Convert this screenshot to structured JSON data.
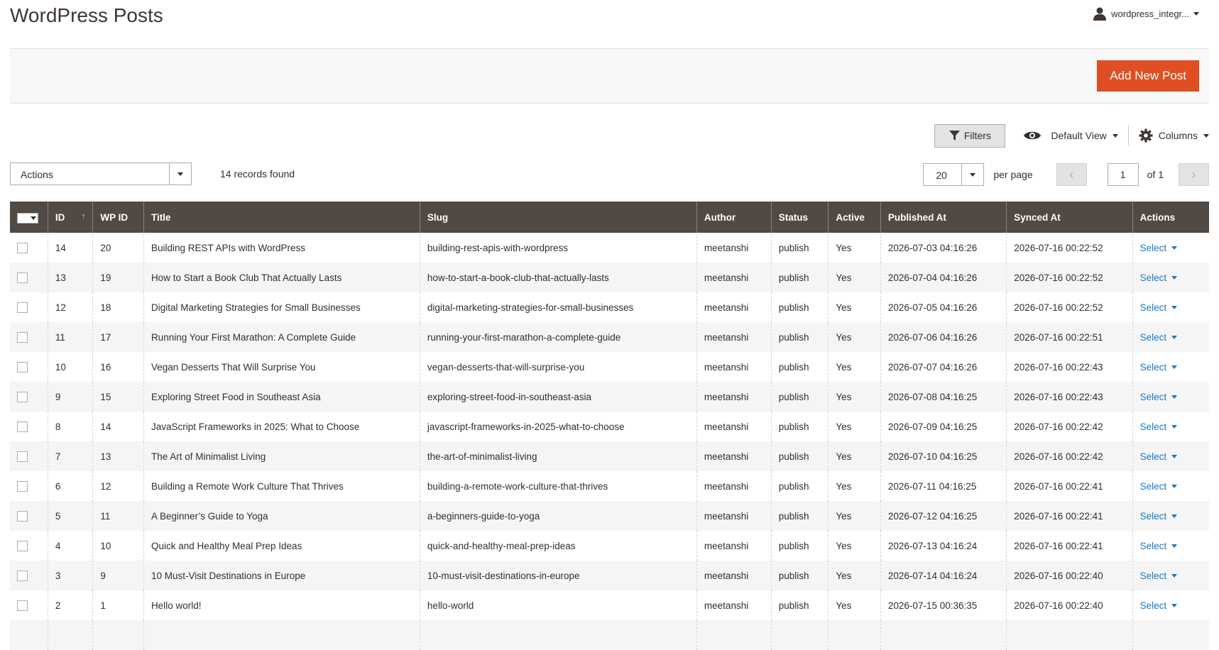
{
  "page": {
    "title": "WordPress Posts"
  },
  "user": {
    "name": "wordpress_integr..."
  },
  "action_bar": {
    "add_button": "Add New Post"
  },
  "toolbar": {
    "filters_label": "Filters",
    "view_label": "Default View",
    "columns_label": "Columns"
  },
  "mass_actions": {
    "label": "Actions"
  },
  "records_found": "14 records found",
  "pager": {
    "per_page_value": "20",
    "per_page_label": "per page",
    "current_page": "1",
    "of_label": "of 1"
  },
  "columns": [
    "ID",
    "WP ID",
    "Title",
    "Slug",
    "Author",
    "Status",
    "Active",
    "Published At",
    "Synced At",
    "Actions"
  ],
  "rows": [
    {
      "id": "14",
      "wp_id": "20",
      "title": "Building REST APIs with WordPress",
      "slug": "building-rest-apis-with-wordpress",
      "author": "meetanshi",
      "status": "publish",
      "active": "Yes",
      "published": "2026-07-03 04:16:26",
      "synced": "2026-07-16 00:22:52",
      "action": "Select"
    },
    {
      "id": "13",
      "wp_id": "19",
      "title": "How to Start a Book Club That Actually Lasts",
      "slug": "how-to-start-a-book-club-that-actually-lasts",
      "author": "meetanshi",
      "status": "publish",
      "active": "Yes",
      "published": "2026-07-04 04:16:26",
      "synced": "2026-07-16 00:22:52",
      "action": "Select"
    },
    {
      "id": "12",
      "wp_id": "18",
      "title": "Digital Marketing Strategies for Small Businesses",
      "slug": "digital-marketing-strategies-for-small-businesses",
      "author": "meetanshi",
      "status": "publish",
      "active": "Yes",
      "published": "2026-07-05 04:16:26",
      "synced": "2026-07-16 00:22:52",
      "action": "Select"
    },
    {
      "id": "11",
      "wp_id": "17",
      "title": "Running Your First Marathon: A Complete Guide",
      "slug": "running-your-first-marathon-a-complete-guide",
      "author": "meetanshi",
      "status": "publish",
      "active": "Yes",
      "published": "2026-07-06 04:16:26",
      "synced": "2026-07-16 00:22:51",
      "action": "Select"
    },
    {
      "id": "10",
      "wp_id": "16",
      "title": "Vegan Desserts That Will Surprise You",
      "slug": "vegan-desserts-that-will-surprise-you",
      "author": "meetanshi",
      "status": "publish",
      "active": "Yes",
      "published": "2026-07-07 04:16:26",
      "synced": "2026-07-16 00:22:43",
      "action": "Select"
    },
    {
      "id": "9",
      "wp_id": "15",
      "title": "Exploring Street Food in Southeast Asia",
      "slug": "exploring-street-food-in-southeast-asia",
      "author": "meetanshi",
      "status": "publish",
      "active": "Yes",
      "published": "2026-07-08 04:16:25",
      "synced": "2026-07-16 00:22:43",
      "action": "Select"
    },
    {
      "id": "8",
      "wp_id": "14",
      "title": "JavaScript Frameworks in 2025: What to Choose",
      "slug": "javascript-frameworks-in-2025-what-to-choose",
      "author": "meetanshi",
      "status": "publish",
      "active": "Yes",
      "published": "2026-07-09 04:16:25",
      "synced": "2026-07-16 00:22:42",
      "action": "Select"
    },
    {
      "id": "7",
      "wp_id": "13",
      "title": "The Art of Minimalist Living",
      "slug": "the-art-of-minimalist-living",
      "author": "meetanshi",
      "status": "publish",
      "active": "Yes",
      "published": "2026-07-10 04:16:25",
      "synced": "2026-07-16 00:22:42",
      "action": "Select"
    },
    {
      "id": "6",
      "wp_id": "12",
      "title": "Building a Remote Work Culture That Thrives",
      "slug": "building-a-remote-work-culture-that-thrives",
      "author": "meetanshi",
      "status": "publish",
      "active": "Yes",
      "published": "2026-07-11 04:16:25",
      "synced": "2026-07-16 00:22:41",
      "action": "Select"
    },
    {
      "id": "5",
      "wp_id": "11",
      "title": "A Beginner’s Guide to Yoga",
      "slug": "a-beginners-guide-to-yoga",
      "author": "meetanshi",
      "status": "publish",
      "active": "Yes",
      "published": "2026-07-12 04:16:25",
      "synced": "2026-07-16 00:22:41",
      "action": "Select"
    },
    {
      "id": "4",
      "wp_id": "10",
      "title": "Quick and Healthy Meal Prep Ideas",
      "slug": "quick-and-healthy-meal-prep-ideas",
      "author": "meetanshi",
      "status": "publish",
      "active": "Yes",
      "published": "2026-07-13 04:16:24",
      "synced": "2026-07-16 00:22:41",
      "action": "Select"
    },
    {
      "id": "3",
      "wp_id": "9",
      "title": "10 Must-Visit Destinations in Europe",
      "slug": "10-must-visit-destinations-in-europe",
      "author": "meetanshi",
      "status": "publish",
      "active": "Yes",
      "published": "2026-07-14 04:16:24",
      "synced": "2026-07-16 00:22:40",
      "action": "Select"
    },
    {
      "id": "2",
      "wp_id": "1",
      "title": "Hello world!",
      "slug": "hello-world",
      "author": "meetanshi",
      "status": "publish",
      "active": "Yes",
      "published": "2026-07-15 00:36:35",
      "synced": "2026-07-16 00:22:40",
      "action": "Select"
    },
    {
      "id": "",
      "wp_id": "",
      "title": "",
      "slug": "",
      "author": "",
      "status": "",
      "active": "",
      "published": "",
      "synced": "",
      "action": ""
    }
  ],
  "colors": {
    "header_bg": "#514943",
    "primary_button": "#e04f23",
    "link": "#1979c3"
  },
  "icons": [
    "user-icon",
    "filter-icon",
    "eye-icon",
    "gear-icon",
    "chevron-left-icon",
    "chevron-right-icon"
  ]
}
